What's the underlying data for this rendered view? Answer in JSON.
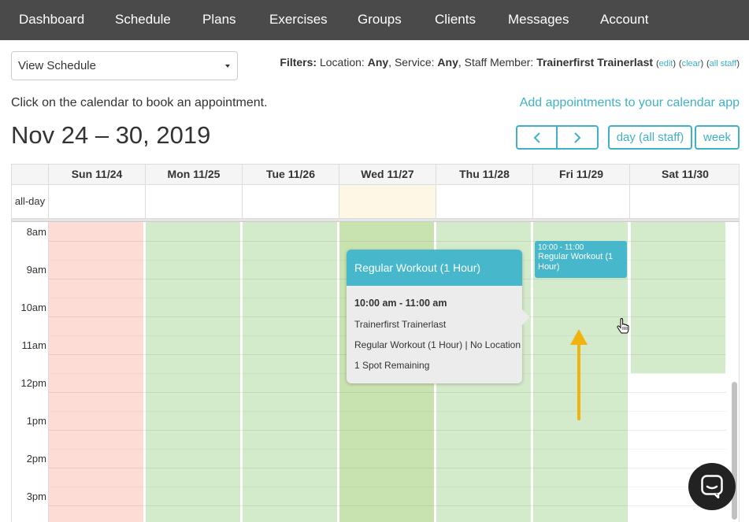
{
  "nav": {
    "items": [
      "Dashboard",
      "Schedule",
      "Plans",
      "Exercises",
      "Groups",
      "Clients",
      "Messages",
      "Account"
    ]
  },
  "view_select": {
    "value": "View Schedule"
  },
  "filters": {
    "label": "Filters:",
    "location_label": "Location:",
    "location_value": "Any",
    "service_label": "Service:",
    "service_value": "Any",
    "staff_label": "Staff Member:",
    "staff_value": "Trainerfirst Trainerlast",
    "edit": "edit",
    "clear": "clear",
    "all_staff": "all staff"
  },
  "hint": "Click on the calendar to book an appointment.",
  "calendar_app_link": "Add appointments to your calendar app",
  "range_title": "Nov 24 – 30, 2019",
  "buttons": {
    "day_all_staff": "day (all staff)",
    "week": "week"
  },
  "days": [
    "Sun 11/24",
    "Mon 11/25",
    "Tue 11/26",
    "Wed 11/27",
    "Thu 11/28",
    "Fri 11/29",
    "Sat 11/30"
  ],
  "allday_label": "all-day",
  "times": [
    "8am",
    "9am",
    "10am",
    "11am",
    "12pm",
    "1pm",
    "2pm",
    "3pm"
  ],
  "colors": {
    "accent": "#3fb0c6",
    "event": "#47b8cc",
    "available": "#d4ebcb",
    "today_available": "#c9e3b0",
    "unavailable": "#fddcd6",
    "today_allday": "#fdf7e5",
    "nav_bg": "#4a4a4a",
    "arrow": "#f0b310"
  },
  "event": {
    "time": "10:00 - 11:00",
    "title": "Regular Workout (1 Hour)"
  },
  "popover": {
    "title": "Regular Workout (1 Hour)",
    "time": "10:00 am - 11:00 am",
    "staff": "Trainerfirst Trainerlast",
    "details": "Regular Workout (1 Hour) | No Location",
    "spots": "1 Spot Remaining"
  },
  "icons": {
    "prev": "chevron-left-icon",
    "next": "chevron-right-icon",
    "cursor": "hand-pointer-icon",
    "chat": "chat-bubble-icon",
    "arrow": "up-arrow-annotation"
  }
}
